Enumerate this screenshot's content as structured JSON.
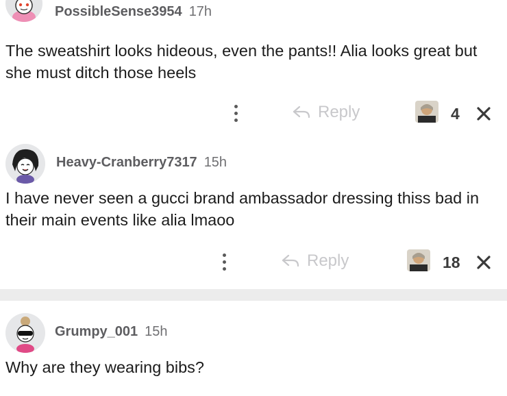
{
  "comments": [
    {
      "username": "PossibleSense3954",
      "time": "17h",
      "body": "The sweatshirt looks hideous, even the pants!! Alia looks great but she must ditch those heels",
      "reply_label": "Reply",
      "count": "4"
    },
    {
      "username": "Heavy-Cranberry7317",
      "time": "15h",
      "body": "I have never seen a gucci brand ambassador dressing thiss bad in their main events like alia lmaoo",
      "reply_label": "Reply",
      "count": "18"
    },
    {
      "username": "Grumpy_001",
      "time": "15h",
      "body": "Why are they wearing bibs?"
    }
  ],
  "icons": {
    "more": "more-options-icon",
    "reply": "reply-arrow-icon",
    "award": "award-avatar-icon",
    "close": "close-icon"
  },
  "colors": {
    "username": "#5d5d60",
    "reply": "#c8c8cb",
    "divider": "#ececec"
  }
}
